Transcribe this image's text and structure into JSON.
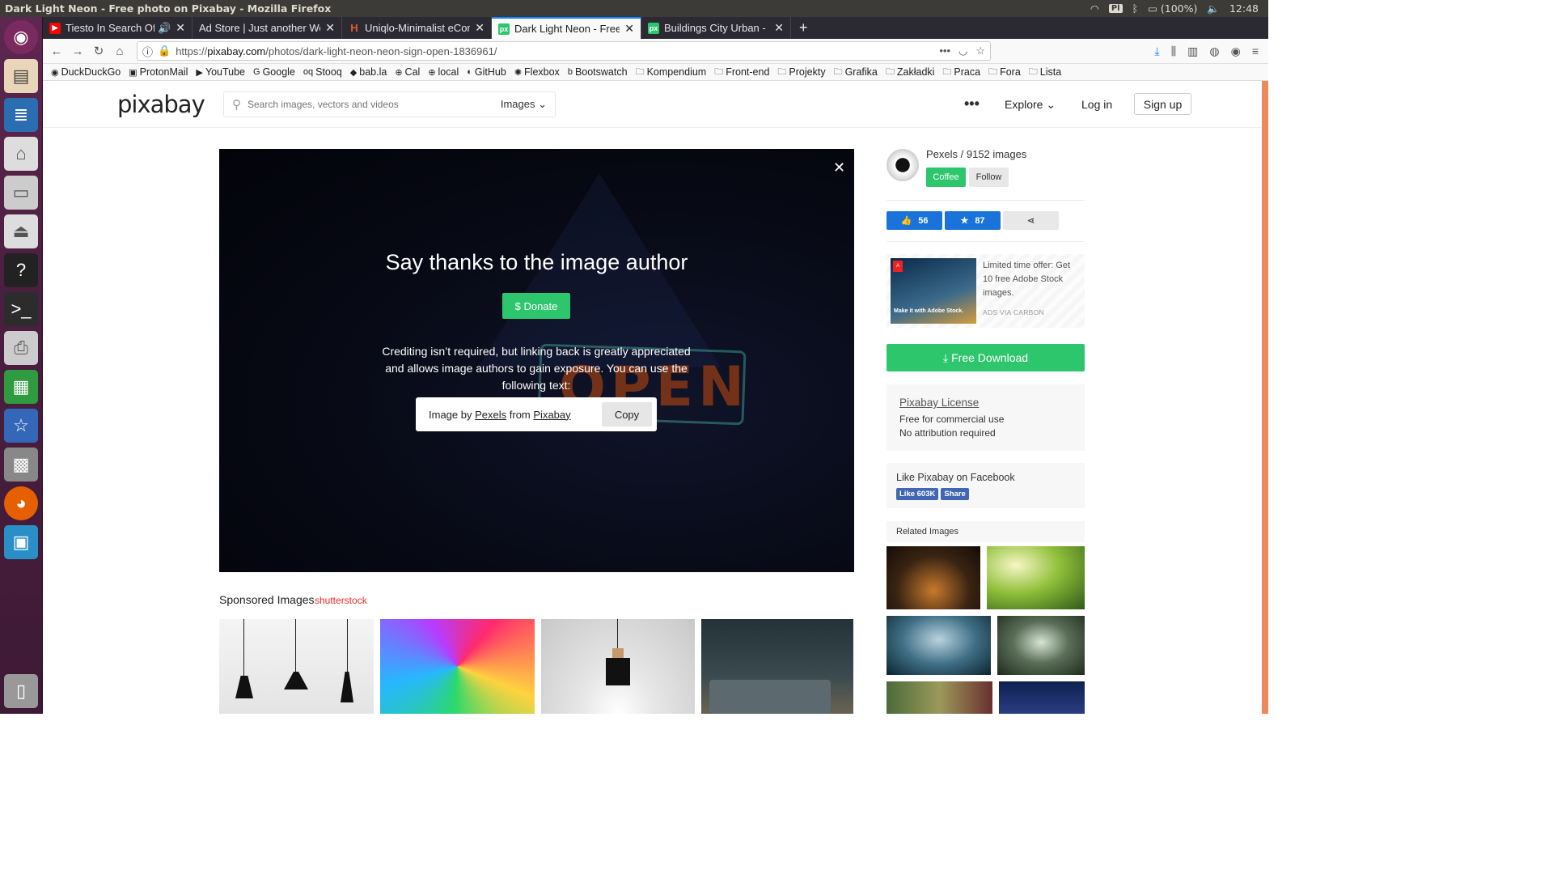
{
  "os": {
    "window_title": "Dark Light Neon - Free photo on Pixabay - Mozilla Firefox",
    "keyboard_layout": "Pl",
    "battery": "(100%)",
    "clock": "12:48"
  },
  "browser": {
    "tabs": [
      {
        "label": "Tiesto In Search Of Su",
        "favicon": "youtube-icon",
        "favicon_color": "#ff0000"
      },
      {
        "label": "Ad Store | Just another Wo",
        "favicon": "none",
        "favicon_color": "#2b2a33"
      },
      {
        "label": "Uniqlo-Minimalist eCom",
        "favicon": "h-icon",
        "favicon_color": "#e85a2b"
      },
      {
        "label": "Dark Light Neon - Free p",
        "favicon": "pixabay-icon",
        "favicon_color": "#2ec66d"
      },
      {
        "label": "Buildings City Urban - Fr",
        "favicon": "pixabay-icon",
        "favicon_color": "#2ec66d"
      }
    ],
    "url_prefix": "https://",
    "url_host": "pixabay.com",
    "url_path": "/photos/dark-light-neon-neon-sign-open-1836961/",
    "bookmarks": [
      "DuckDuckGo",
      "ProtonMail",
      "YouTube",
      "Google",
      "Stooq",
      "bab.la",
      "Cal",
      "local",
      "GitHub",
      "Flexbox",
      "Bootswatch",
      "Kompendium",
      "Front-end",
      "Projekty",
      "Grafika",
      "Zakładki",
      "Praca",
      "Fora",
      "Lista"
    ]
  },
  "header": {
    "logo": "pixabay",
    "search_placeholder": "Search images, vectors and videos",
    "search_type": "Images",
    "more": "•••",
    "explore": "Explore",
    "login": "Log in",
    "signup": "Sign up"
  },
  "modal": {
    "title": "Say thanks to the image author",
    "donate": "$ Donate",
    "credit_text": "Crediting isn’t required, but linking back is greatly appreciated and allows image authors to gain exposure. You can use the following text:",
    "attr_prefix": "Image by",
    "attr_author": "Pexels",
    "attr_mid": "from",
    "attr_site": "Pixabay",
    "copy": "Copy",
    "bg_sign_text": "OPEN"
  },
  "sponsored": {
    "label": "Sponsored Images",
    "brand": "shutterstock"
  },
  "sidebar": {
    "author": "Pexels / 9152 images",
    "coffee": "Coffee",
    "follow": "Follow",
    "likes": "56",
    "favorites": "87",
    "ad_text": "Limited time offer: Get 10 free Adobe Stock images.",
    "ad_by": "ADS VIA CARBON",
    "ad_image_caption": "Make it with Adobe Stock.",
    "free_download": "Free Download",
    "license_title": "Pixabay License",
    "license_line1": "Free for commercial use",
    "license_line2": "No attribution required",
    "fb_title": "Like Pixabay on Facebook",
    "fb_like": "Like 603K",
    "fb_share": "Share",
    "related_title": "Related Images"
  },
  "colors": {
    "accent_green": "#2ec66d",
    "like_blue": "#1a73d9",
    "scroll_orange": "#ec8a5e"
  }
}
